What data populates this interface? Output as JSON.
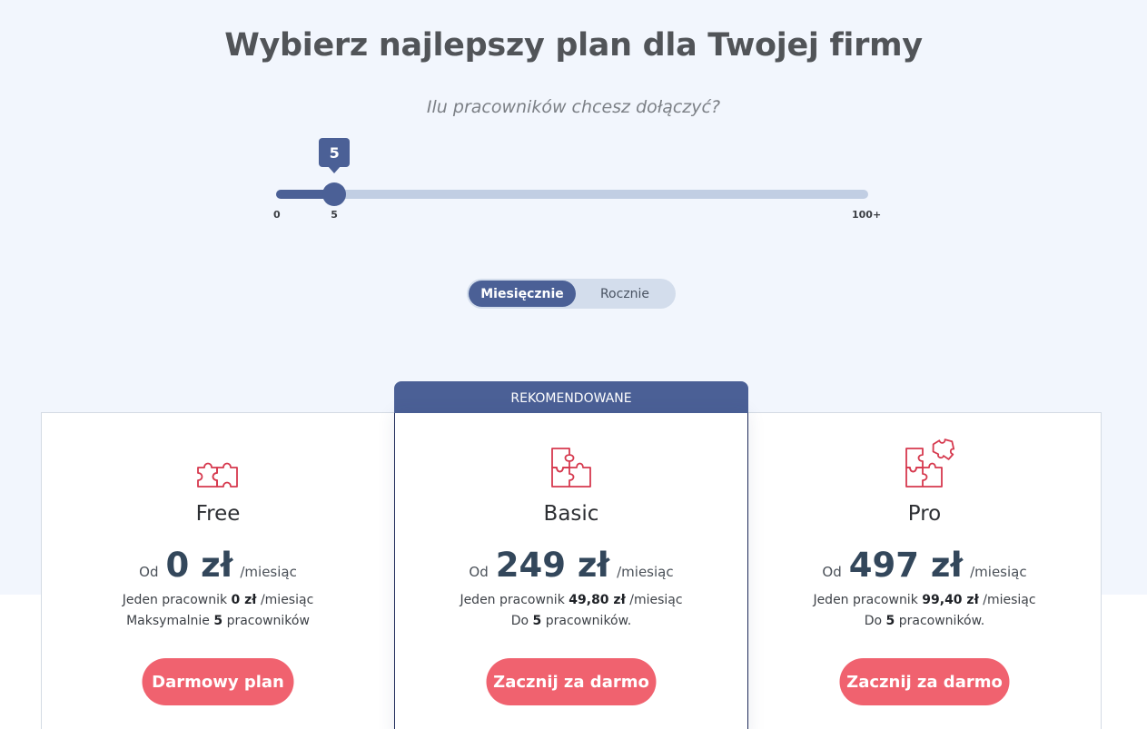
{
  "header": {
    "title": "Wybierz najlepszy plan dla Twojej firmy",
    "subtitle": "Ilu pracowników chcesz dołączyć?"
  },
  "slider": {
    "value": 5,
    "value_label": "5",
    "min": 0,
    "max": 100,
    "min_label": "0",
    "max_label": "100+"
  },
  "billing_toggle": {
    "monthly": "Miesięcznie",
    "yearly": "Rocznie",
    "selected": "monthly"
  },
  "recommended_badge": "REKOMENDOWANE",
  "colors": {
    "primary": "#4b6096",
    "accent": "#f0626f",
    "icon": "#d6394e"
  },
  "plans": [
    {
      "name": "Free",
      "icon": "puzzle-small-icon",
      "price_prefix": "Od",
      "price": "0 zł",
      "period": "/miesiąc",
      "per_employee_label": "Jeden pracownik",
      "per_employee_price": "0 zł",
      "per_employee_period": "/miesiąc",
      "limit_prefix": "Maksymalnie",
      "limit_count": "5",
      "limit_suffix": "pracowników",
      "cta": "Darmowy plan"
    },
    {
      "name": "Basic",
      "icon": "puzzle-medium-icon",
      "price_prefix": "Od",
      "price": "249 zł",
      "period": "/miesiąc",
      "per_employee_label": "Jeden pracownik",
      "per_employee_price": "49,80 zł",
      "per_employee_period": "/miesiąc",
      "limit_prefix": "Do",
      "limit_count": "5",
      "limit_suffix": "pracowników.",
      "cta": "Zacznij za darmo"
    },
    {
      "name": "Pro",
      "icon": "puzzle-large-icon",
      "price_prefix": "Od",
      "price": "497 zł",
      "period": "/miesiąc",
      "per_employee_label": "Jeden pracownik",
      "per_employee_price": "99,40 zł",
      "per_employee_period": "/miesiąc",
      "limit_prefix": "Do",
      "limit_count": "5",
      "limit_suffix": "pracowników.",
      "cta": "Zacznij za darmo"
    }
  ]
}
